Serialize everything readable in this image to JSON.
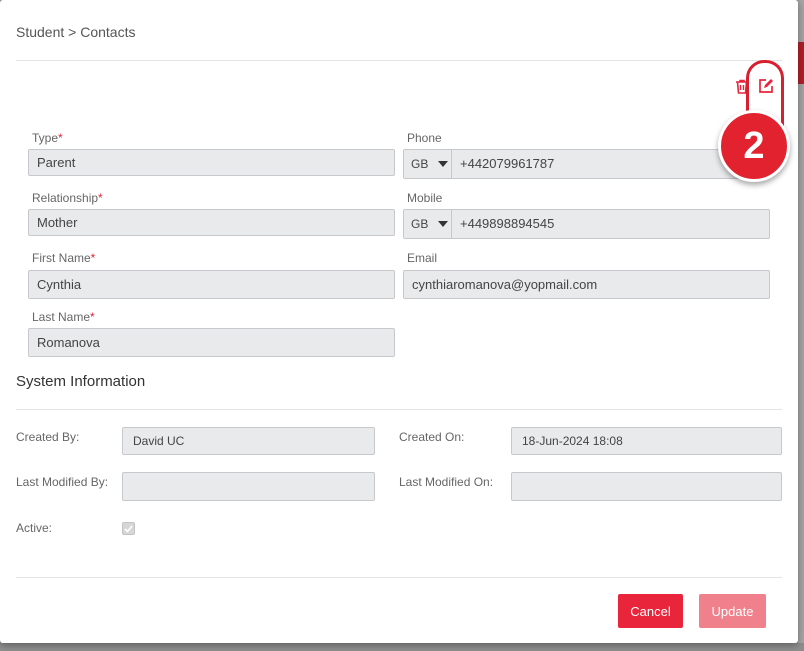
{
  "breadcrumb": "Student > Contacts",
  "actions": {
    "delete_icon": "trash-icon",
    "edit_icon": "edit-icon"
  },
  "contact": {
    "type_label": "Type",
    "type_value": "Parent",
    "relationship_label": "Relationship",
    "relationship_value": "Mother",
    "first_name_label": "First Name",
    "first_name_value": "Cynthia",
    "last_name_label": "Last Name",
    "last_name_value": "Romanova",
    "phone_label": "Phone",
    "phone_country": "GB",
    "phone_value": "+442079961787",
    "mobile_label": "Mobile",
    "mobile_country": "GB",
    "mobile_value": "+449898894545",
    "email_label": "Email",
    "email_value": "cynthiaromanova@yopmail.com",
    "required_mark": "*"
  },
  "system": {
    "title": "System Information",
    "created_by_label": "Created By:",
    "created_by_value": "David UC",
    "created_on_label": "Created On:",
    "created_on_value": "18-Jun-2024 18:08",
    "modified_by_label": "Last Modified By:",
    "modified_by_value": "",
    "modified_on_label": "Last Modified On:",
    "modified_on_value": "",
    "active_label": "Active:",
    "active_checked": true
  },
  "footer": {
    "cancel_label": "Cancel",
    "update_label": "Update"
  },
  "annotation": {
    "number": "2"
  },
  "colors": {
    "accent": "#e8253a",
    "field_bg": "#e9eaec",
    "callout": "#e2232f"
  }
}
